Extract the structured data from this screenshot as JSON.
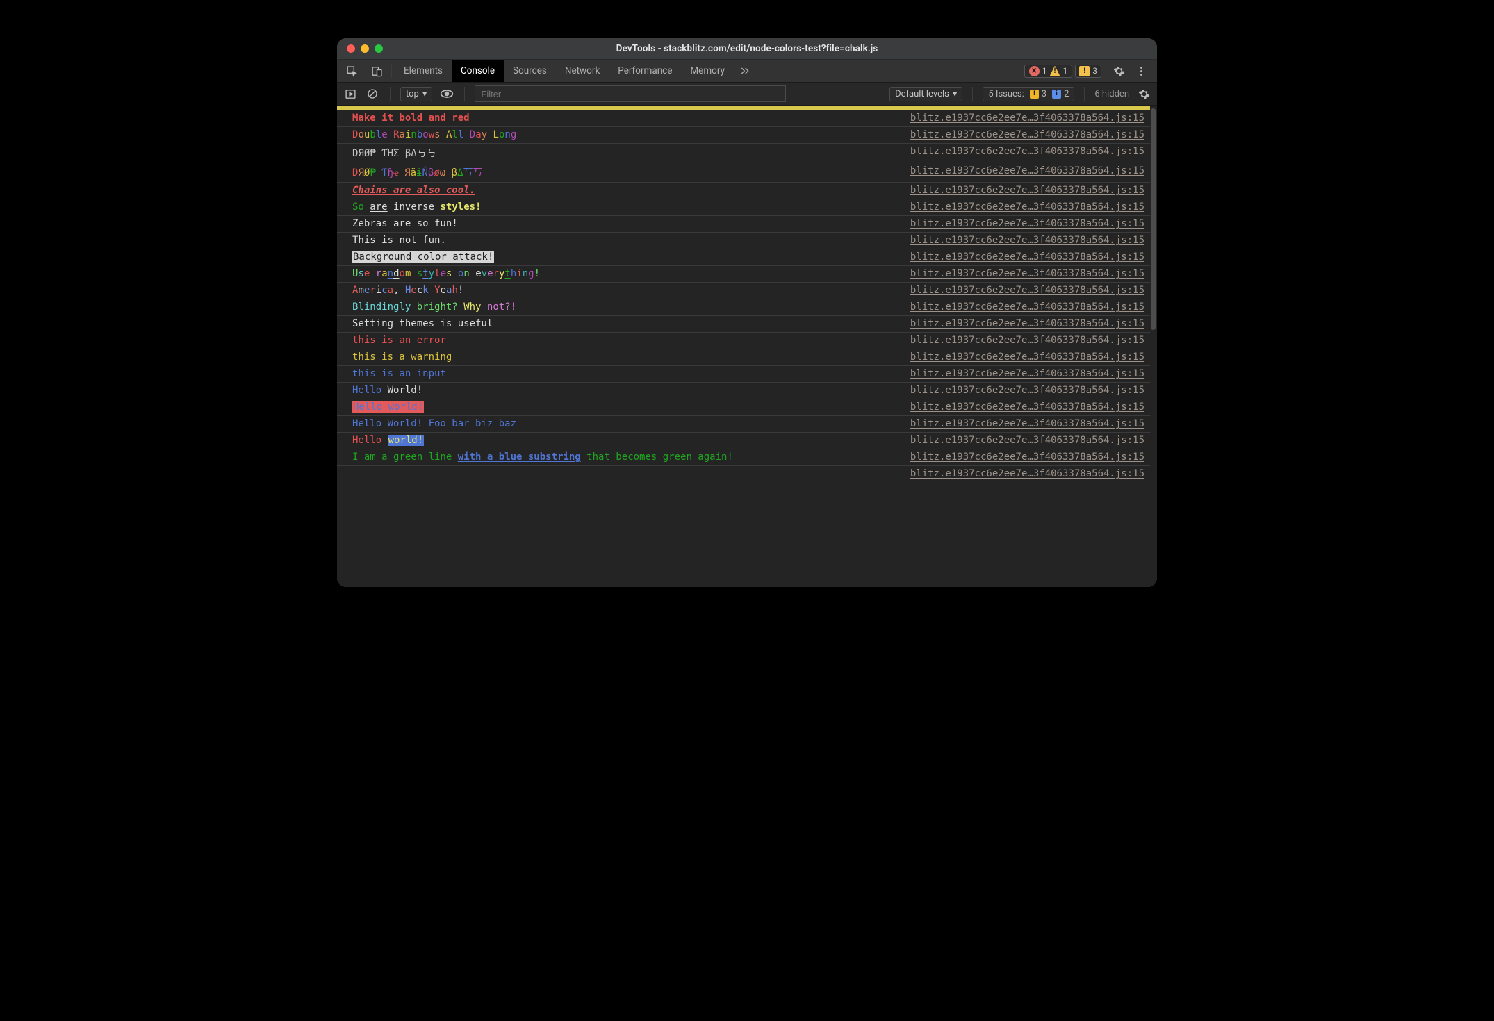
{
  "window": {
    "title": "DevTools - stackblitz.com/edit/node-colors-test?file=chalk.js"
  },
  "tabstrip": {
    "tabs": [
      "Elements",
      "Console",
      "Sources",
      "Network",
      "Performance",
      "Memory"
    ],
    "active": "Console",
    "more_icon": "chevrons-icon",
    "errors": "1",
    "warnings": "1",
    "issues": "3"
  },
  "filterbar": {
    "context": "top",
    "filter_placeholder": "Filter",
    "levels": "Default levels",
    "issues_label": "5 Issues:",
    "issues_warn": "3",
    "issues_info": "2",
    "hidden": "6 hidden"
  },
  "source_link": "blitz.e1937cc6e2ee7e…3f4063378a564.js:15",
  "entries": [
    {
      "html": "<span class='b c-red'>Make it bold and red</span>"
    },
    {
      "html": "<span class='c-red'>D</span><span class='c-orange'>o</span><span class='c-yellow'>u</span><span class='c-green'>b</span><span class='c-blue'>l</span><span class='c-magenta'>e</span><span> </span><span class='c-red'>R</span><span class='c-orange'>a</span><span class='c-yellow'>i</span><span class='c-green'>n</span><span class='c-blue'>b</span><span class='c-magenta'>o</span><span class='c-red'>w</span><span class='c-orange'>s</span><span> </span><span class='c-yellow'>A</span><span class='c-green'>l</span><span class='c-blue'>l</span><span> </span><span class='c-magenta'>D</span><span class='c-red'>a</span><span class='c-orange'>y</span><span> </span><span class='c-yellow'>L</span><span class='c-green'>o</span><span class='c-blue'>n</span><span class='c-magenta'>g</span>"
    },
    {
      "html": "<span class='c-gray'>DЯØ₱ ƬΉΣ βΔ丂丂</span>"
    },
    {
      "html": "<span class='c-red'>Ð</span><span class='c-orange'>Я</span><span class='c-yellow'>Ø</span><span class='c-green'>₱</span> <span class='c-blue'>Ƭ</span><span class='c-magenta'>ɧ</span><span class='c-red'>ҽ</span> <span class='c-orange'>Я</span><span class='c-yellow'>ǟ</span><span class='c-green'>ɨ</span><span class='c-blue'>Ň</span><span class='c-magenta'>β</span><span class='c-red'>ø</span><span class='c-orange'>ω</span> <span class='c-yellow'>β</span><span class='c-green'>Δ</span><span class='c-blue'>丂</span><span class='c-magenta'>丂</span>"
    },
    {
      "html": "<span class='b i u c-brightred'>Chains are also cool.</span>"
    },
    {
      "html": "<span class='c-green'>So</span> <span class='u c-white'>are</span> <span class='c-white'>inverse</span> <span class='b c-brightyellow'>styles!</span>"
    },
    {
      "html": "<span class='c-white'>Zebras are so fun!</span>"
    },
    {
      "html": "<span class='c-white'>This is </span><span class='strike c-white'>not</span><span class='c-white'> fun.</span>"
    },
    {
      "html": "<span class='inv-w'>Background color attack!</span>"
    },
    {
      "html": "<span class='c-brightgreen'>U</span><span class='c-brightcyan'>s</span><span class='c-red'>e</span> <span class='c-brightmagenta'>r</span><span class='c-yellow'>a</span><span class='u c-blue'>n</span><span class='u c-white'>d</span><span class='c-red'>o</span><span class='c-yellow'>m</span> <span class='c-green'>s</span><span class='u c-brightblue'>t</span><span class='c-cyan'>y</span><span class='c-brightred'>l</span><span class='c-magenta'>e</span><span class='c-brightyellow'>s</span> <span class='c-blue'>o</span><span class='c-brightgreen'>n</span> <span class='c-white'>e</span><span class='c-cyan'>v</span><span class='c-brightmagenta'>e</span><span class='c-red'>r</span><span class='c-brightyellow'>y</span><span class='u c-green'>t</span><span class='c-blue'>h</span><span class='c-brightred'>i</span><span class='c-cyan'>n</span><span class='c-magenta'>g</span><span class='c-brightgreen'>!</span>"
    },
    {
      "html": "<span class='c-brightred'>A</span><span class='c-white'>m</span><span class='c-brightblue'>e</span><span class='c-brightred'>r</span><span class='c-white'>i</span><span class='c-brightblue'>c</span><span class='c-brightred'>a</span><span class='c-white'>,</span> <span class='c-brightblue'>H</span><span class='c-brightred'>e</span><span class='c-white'>c</span><span class='c-brightblue'>k</span> <span class='c-brightred'>Y</span><span class='c-white'>e</span><span class='c-brightblue'>a</span><span class='c-brightred'>h</span><span class='c-white'>!</span>"
    },
    {
      "html": "<span class='c-brightcyan'>Blindingly</span> <span class='c-brightgreen'>bright?</span> <span class='c-brightyellow'>Why</span> <span class='c-brightmagenta'>not?!</span>"
    },
    {
      "html": "<span class='c-white'>Setting themes is useful</span>"
    },
    {
      "html": "<span class='c-red'>this is an error</span>"
    },
    {
      "html": "<span class='c-yellow'>this is a warning</span>"
    },
    {
      "html": "<span class='c-blue'>this is an input</span>"
    },
    {
      "html": "<span class='c-blue'>Hello</span><span class='c-white'> World!</span>"
    },
    {
      "html": "<span class='bg-red c-blue'>Hello world!</span>"
    },
    {
      "html": "<span class='c-blue'>Hello World! Foo bar biz baz</span>"
    },
    {
      "html": "<span class='c-red'>Hello </span><span class='bg-blue c-brightyellow'>world!</span>"
    },
    {
      "html": "<span class='c-green'>I am a green line </span><span class='b u c-blue'>with a blue substring</span><span class='c-green'> that becomes green again!</span>"
    },
    {
      "html": "<span> </span>",
      "last": true
    }
  ]
}
